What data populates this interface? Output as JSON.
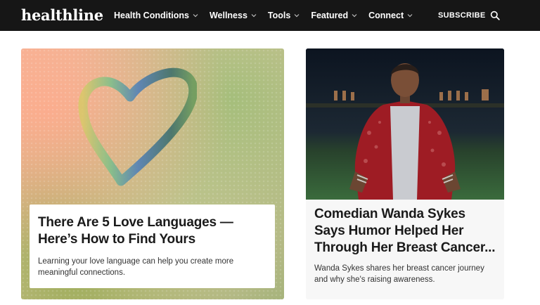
{
  "header": {
    "logo": "healthline",
    "nav": [
      {
        "label": "Health Conditions"
      },
      {
        "label": "Wellness"
      },
      {
        "label": "Tools"
      },
      {
        "label": "Featured"
      },
      {
        "label": "Connect"
      }
    ],
    "subscribe_label": "SUBSCRIBE",
    "search_icon": "search-icon"
  },
  "cards": [
    {
      "title": "There Are 5 Love Languages — Here’s How to Find Yours",
      "description": "Learning your love language can help you create more meaningful connections.",
      "image": "heart drawn on foggy window"
    },
    {
      "title": "Comedian Wanda Sykes Says Humor Helped Her Through Her Breast Cancer...",
      "description": "Wanda Sykes shares her breast cancer journey and why she's raising awareness.",
      "image": "woman in red sequin jacket in stadium at night"
    }
  ],
  "colors": {
    "header_bg": "#161616",
    "header_text": "#ffffff",
    "card_bg": "#f7f7f7"
  }
}
